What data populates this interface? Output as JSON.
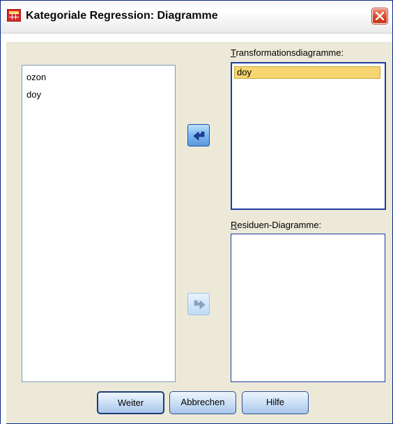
{
  "window": {
    "title": "Kategoriale Regression: Diagramme",
    "icons": {
      "app": "spss-table-icon",
      "close": "close-icon"
    }
  },
  "source_list": {
    "items": [
      "ozon",
      "doy"
    ]
  },
  "transform_group": {
    "label_underlined": "T",
    "label_rest": "ransformationsdiagramme:",
    "items": [
      "doy"
    ],
    "selected": "doy"
  },
  "residuen_group": {
    "label_underlined": "R",
    "label_rest": "esiduen-Diagramme:",
    "items": []
  },
  "move_buttons": {
    "to_source_icon": "arrow-left-icon",
    "to_residuen_icon": "arrow-right-icon"
  },
  "buttons": {
    "continue": "Weiter",
    "cancel": "Abbrechen",
    "help": "Hilfe"
  },
  "colors": {
    "selection": "#f7d570",
    "active_border": "#1f3aa0",
    "close_button": "#d9472a"
  }
}
